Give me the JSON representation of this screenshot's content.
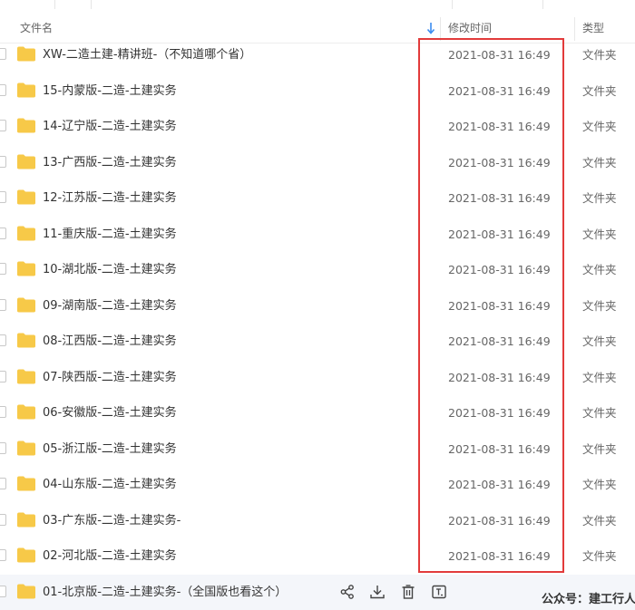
{
  "header": {
    "name_col": "文件名",
    "date_col": "修改时间",
    "type_col": "类型"
  },
  "files": [
    {
      "name": "XW-二造土建-精讲班-（不知道哪个省）",
      "date": "2021-08-31 16:49",
      "type": "文件夹"
    },
    {
      "name": "15-内蒙版-二造-土建实务",
      "date": "2021-08-31 16:49",
      "type": "文件夹"
    },
    {
      "name": "14-辽宁版-二造-土建实务",
      "date": "2021-08-31 16:49",
      "type": "文件夹"
    },
    {
      "name": "13-广西版-二造-土建实务",
      "date": "2021-08-31 16:49",
      "type": "文件夹"
    },
    {
      "name": "12-江苏版-二造-土建实务",
      "date": "2021-08-31 16:49",
      "type": "文件夹"
    },
    {
      "name": "11-重庆版-二造-土建实务",
      "date": "2021-08-31 16:49",
      "type": "文件夹"
    },
    {
      "name": "10-湖北版-二造-土建实务",
      "date": "2021-08-31 16:49",
      "type": "文件夹"
    },
    {
      "name": "09-湖南版-二造-土建实务",
      "date": "2021-08-31 16:49",
      "type": "文件夹"
    },
    {
      "name": "08-江西版-二造-土建实务",
      "date": "2021-08-31 16:49",
      "type": "文件夹"
    },
    {
      "name": "07-陕西版-二造-土建实务",
      "date": "2021-08-31 16:49",
      "type": "文件夹"
    },
    {
      "name": "06-安徽版-二造-土建实务",
      "date": "2021-08-31 16:49",
      "type": "文件夹"
    },
    {
      "name": "05-浙江版-二造-土建实务",
      "date": "2021-08-31 16:49",
      "type": "文件夹"
    },
    {
      "name": "04-山东版-二造-土建实务",
      "date": "2021-08-31 16:49",
      "type": "文件夹"
    },
    {
      "name": "03-广东版-二造-土建实务-",
      "date": "2021-08-31 16:49",
      "type": "文件夹"
    },
    {
      "name": "02-河北版-二造-土建实务",
      "date": "2021-08-31 16:49",
      "type": "文件夹"
    },
    {
      "name": "01-北京版-二造-土建实务-（全国版也看这个）",
      "date": "",
      "type": ""
    }
  ],
  "watermark": "公众号：建工行人",
  "colors": {
    "folder": "#f7c948",
    "highlight": "#e23b3b",
    "sort_arrow": "#3b8cf0"
  },
  "icons": [
    "folder-icon",
    "share-icon",
    "download-icon",
    "delete-icon",
    "rename-icon",
    "sort-desc-icon"
  ]
}
